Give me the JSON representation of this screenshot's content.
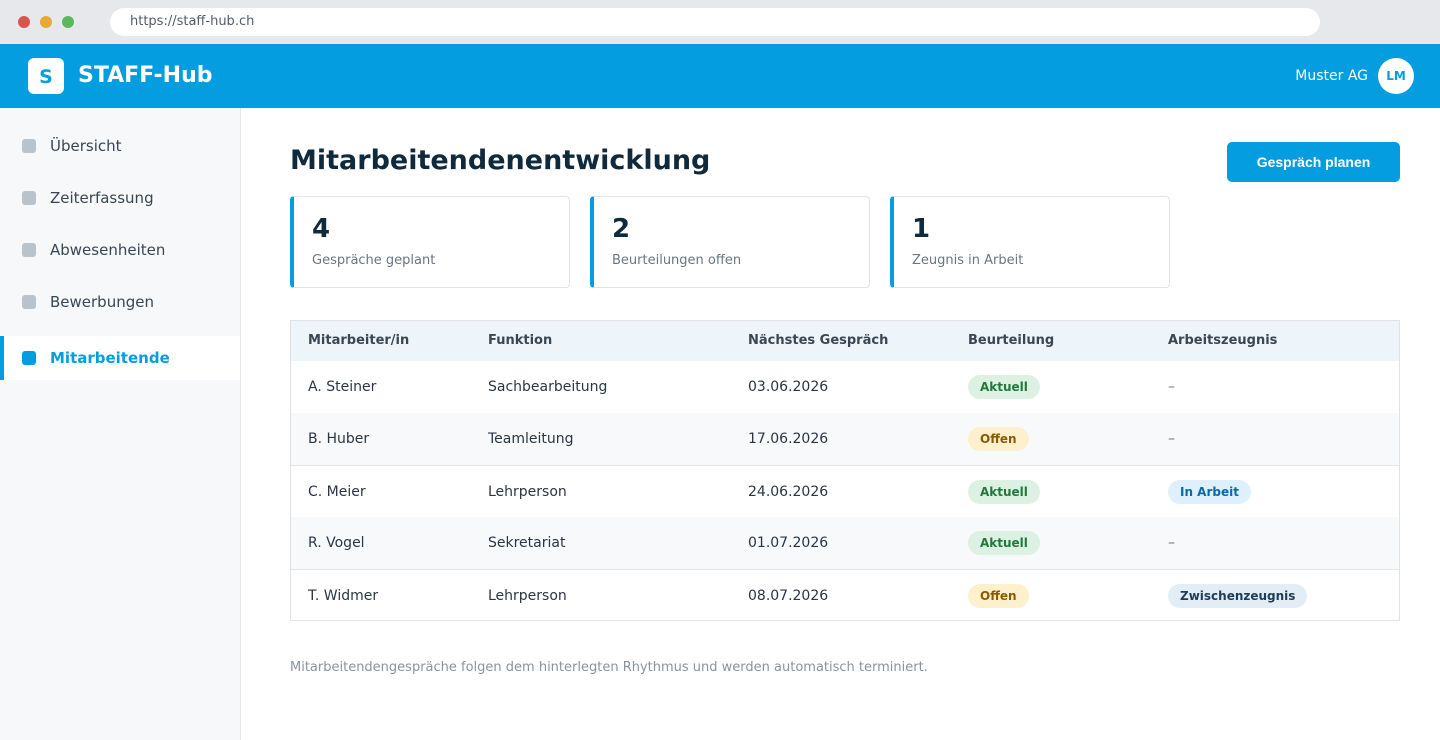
{
  "browser": {
    "url": "https://staff-hub.ch"
  },
  "header": {
    "logo_letter": "S",
    "app_name": "STAFF-Hub",
    "org_name": "Muster AG",
    "avatar_initials": "LM",
    "brand_color": "#039de0"
  },
  "sidebar": {
    "items": [
      {
        "label": "Übersicht",
        "active": false
      },
      {
        "label": "Zeiterfassung",
        "active": false
      },
      {
        "label": "Abwesenheiten",
        "active": false
      },
      {
        "label": "Bewerbungen",
        "active": false
      },
      {
        "label": "Mitarbeitende",
        "active": true
      }
    ]
  },
  "main": {
    "title": "Mitarbeitendenentwicklung",
    "primary_action": "Gespräch planen",
    "stats": [
      {
        "value": "4",
        "label": "Gespräche geplant"
      },
      {
        "value": "2",
        "label": "Beurteilungen offen"
      },
      {
        "value": "1",
        "label": "Zeugnis in Arbeit"
      }
    ],
    "table": {
      "columns": [
        "Mitarbeiter/in",
        "Funktion",
        "Nächstes Gespräch",
        "Beurteilung",
        "Arbeitszeugnis"
      ],
      "rows": [
        {
          "name": "A. Steiner",
          "function": "Sachbearbeitung",
          "next_meeting": "03.06.2026",
          "assessment": "Aktuell",
          "certificate": "–"
        },
        {
          "name": "B. Huber",
          "function": "Teamleitung",
          "next_meeting": "17.06.2026",
          "assessment": "Offen",
          "certificate": "–"
        },
        {
          "name": "C. Meier",
          "function": "Lehrperson",
          "next_meeting": "24.06.2026",
          "assessment": "Aktuell",
          "certificate": "In Arbeit"
        },
        {
          "name": "R. Vogel",
          "function": "Sekretariat",
          "next_meeting": "01.07.2026",
          "assessment": "Aktuell",
          "certificate": "–"
        },
        {
          "name": "T. Widmer",
          "function": "Lehrperson",
          "next_meeting": "08.07.2026",
          "assessment": "Offen",
          "certificate": "Zwischenzeugnis"
        }
      ]
    },
    "footnote": "Mitarbeitendengespräche folgen dem hinterlegten Rhythmus und werden automatisch terminiert."
  }
}
